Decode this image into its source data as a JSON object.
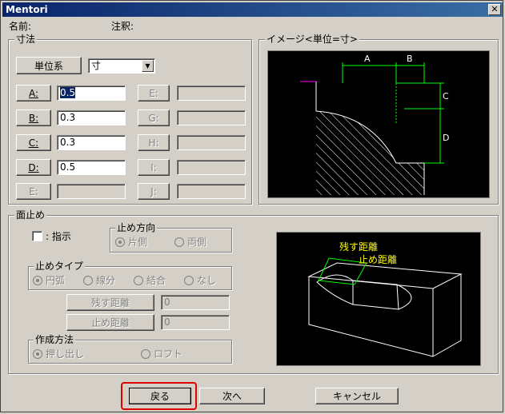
{
  "window": {
    "title": "Mentori",
    "close_glyph": "✕"
  },
  "header": {
    "name_label": "名前:",
    "note_label": "注釈:"
  },
  "dimension_group": {
    "legend": "寸法",
    "unit_button": "単位系",
    "unit_select_value": "寸",
    "rows": [
      {
        "left_label": "A:",
        "left_value": "0.5",
        "right_label": "E:",
        "right_value": ""
      },
      {
        "left_label": "B:",
        "left_value": "0.3",
        "right_label": "G:",
        "right_value": ""
      },
      {
        "left_label": "C:",
        "left_value": "0.3",
        "right_label": "H:",
        "right_value": ""
      },
      {
        "left_label": "D:",
        "left_value": "0.5",
        "right_label": "I:",
        "right_value": ""
      },
      {
        "left_label": "E:",
        "left_value": "",
        "right_label": "J:",
        "right_value": ""
      }
    ]
  },
  "image_group": {
    "legend": "イメージ<単位=寸>",
    "labels": {
      "a": "A",
      "b": "B",
      "c": "C",
      "d": "D"
    }
  },
  "stop_group": {
    "legend": "面止め",
    "indicate_label": ": 指示",
    "direction": {
      "legend": "止め方向",
      "options": [
        "片側",
        "両側"
      ]
    },
    "type": {
      "legend": "止めタイプ",
      "options": [
        "円弧",
        "線分",
        "結合",
        "なし"
      ]
    },
    "remain_button": "残す距離",
    "remain_value": "0",
    "stop_button": "止め距離",
    "stop_value": "0",
    "method": {
      "legend": "作成方法",
      "options": [
        "押し出し",
        "ロフト"
      ]
    },
    "preview_labels": {
      "remain": "残す距離",
      "stop": "止め距離"
    }
  },
  "footer": {
    "back": "戻る",
    "next": "次へ",
    "cancel": "キャンセル"
  },
  "colors": {
    "highlight": "#e00000",
    "dim_green": "#00ff00",
    "preview_yellow": "#ffff00",
    "marker_magenta": "#ff00ff"
  }
}
